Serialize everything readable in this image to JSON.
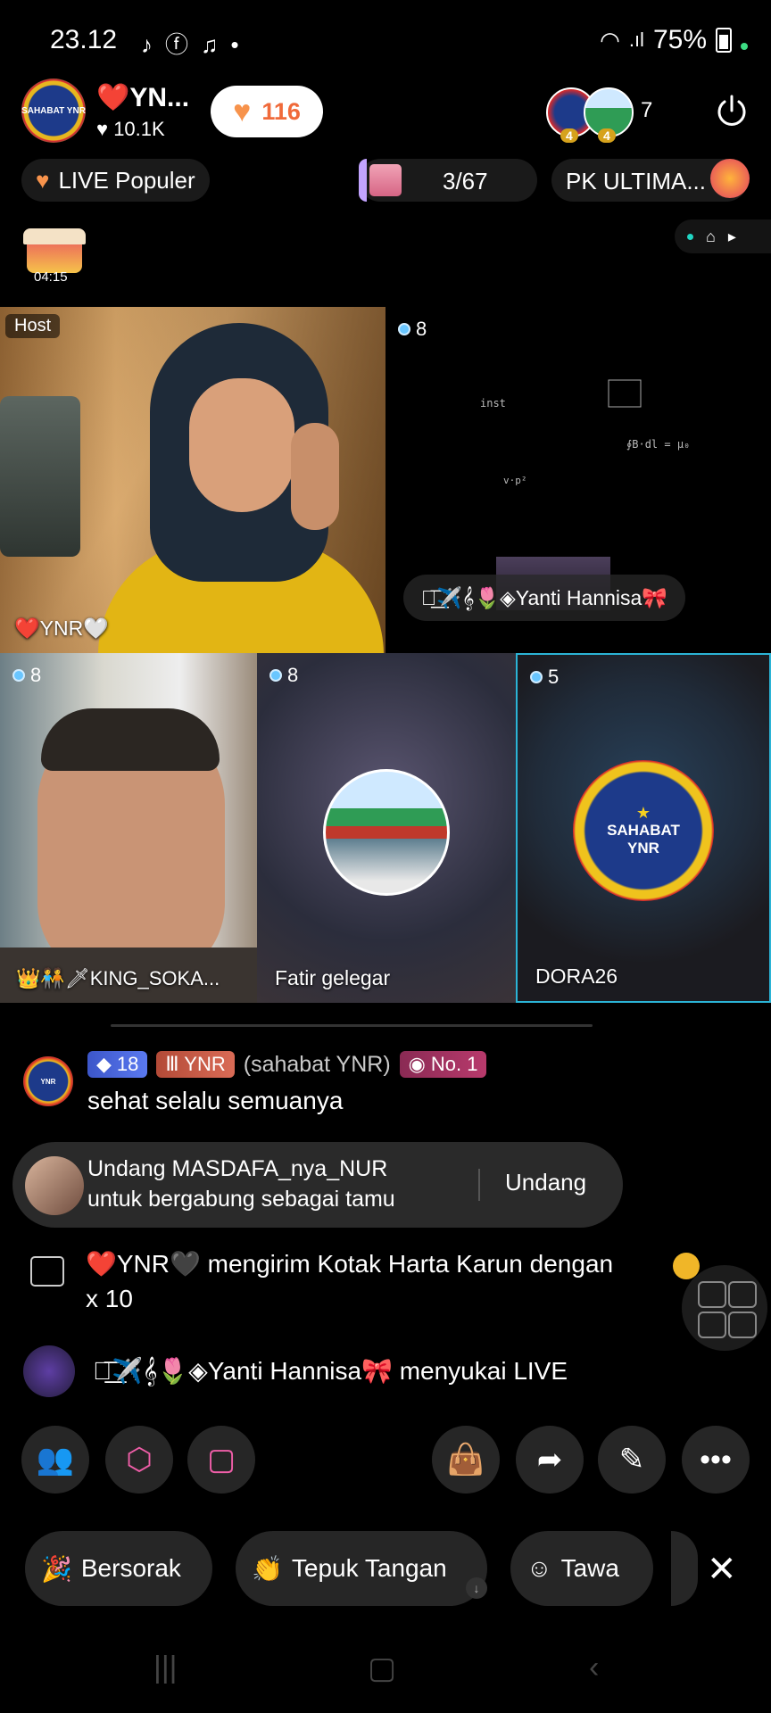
{
  "status": {
    "time": "23.12",
    "notif_icons": [
      "tiktok-icon",
      "facebook-icon",
      "tiktok-lite-icon",
      "dot-icon"
    ],
    "battery": "75%"
  },
  "host": {
    "avatar_text": "SAHABAT YNR",
    "name": "❤️YN...",
    "likes": "10.1K",
    "follow_count": "116"
  },
  "viewers": {
    "badge_a": "4",
    "badge_b": "4",
    "count": "7"
  },
  "row2": {
    "live_popular": "LIVE Populer",
    "gift_progress": "3/67",
    "gift_progress_value": 0.045,
    "pk_label": "PK ULTIMA..."
  },
  "chest": {
    "timer": "04:15"
  },
  "grid": {
    "host_tag": "Host",
    "host_name": "❤️YNR🤍",
    "guest1": {
      "count": "8",
      "name": "⸺͟͞✈️𝄞🌷◈Yanti Hannisa🎀"
    },
    "guest2": {
      "count": "8",
      "name": "👑🧑‍🤝‍🧑🗡KING_SOKA..."
    },
    "guest3": {
      "count": "8",
      "name": "Fatir gelegar"
    },
    "guest4": {
      "count": "5",
      "name": "DORA26",
      "avatar_line1": "SAHABAT",
      "avatar_line2": "YNR"
    }
  },
  "chat": {
    "msg1": {
      "level": "18",
      "fan_badge": "YNR",
      "user": "(sahabat YNR)",
      "rank": "No. 1",
      "text": "sehat selalu semuanya"
    },
    "invite": {
      "line1": "Undang MASDAFA_nya_NUR",
      "line2": "untuk bergabung sebagai tamu",
      "button": "Undang"
    },
    "gift": {
      "line1": "❤️YNR🖤 mengirim Kotak Harta Karun dengan",
      "line2": "x 10"
    },
    "like": {
      "text": "⸺͟͞✈️𝄞🌷◈Yanti Hannisa🎀 menyukai LIVE"
    }
  },
  "reactions": {
    "cheer": "Bersorak",
    "clap": "Tepuk Tangan",
    "laugh": "Tawa"
  },
  "colors": {
    "accent_follow": "#f06a3a",
    "selected_border": "#2bb4d6",
    "level_badge": "#4766dd",
    "fan_badge": "#c65846"
  }
}
